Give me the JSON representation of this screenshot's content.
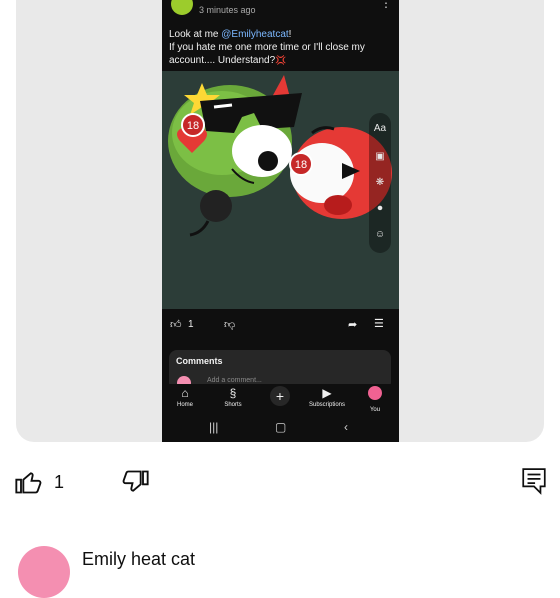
{
  "post": {
    "time": "3 minutes ago",
    "text_prefix": "Look at me ",
    "mention": "@Emilyheatcat",
    "text_suffix": "!",
    "text_line2": "If you hate me one more time or I'll close my account.... Understand?",
    "text_emoji": "💢"
  },
  "editor_tools": {
    "text_tool": "Aa"
  },
  "stickers": {
    "badge1": "18",
    "badge2": "18"
  },
  "actions": {
    "like_count": "1"
  },
  "comments": {
    "title": "Comments",
    "placeholder": "Add a comment..."
  },
  "nav": {
    "items": [
      {
        "label": "Home"
      },
      {
        "label": "Shorts"
      },
      {
        "label": ""
      },
      {
        "label": "Subscriptions"
      },
      {
        "label": "You"
      }
    ]
  },
  "bottom": {
    "like_count": "1"
  },
  "author": {
    "name": "Emily heat cat"
  },
  "colors": {
    "mention": "#7cb8ff",
    "card_bg": "#e9e9e9",
    "phone_bg": "#0f0f0f"
  }
}
